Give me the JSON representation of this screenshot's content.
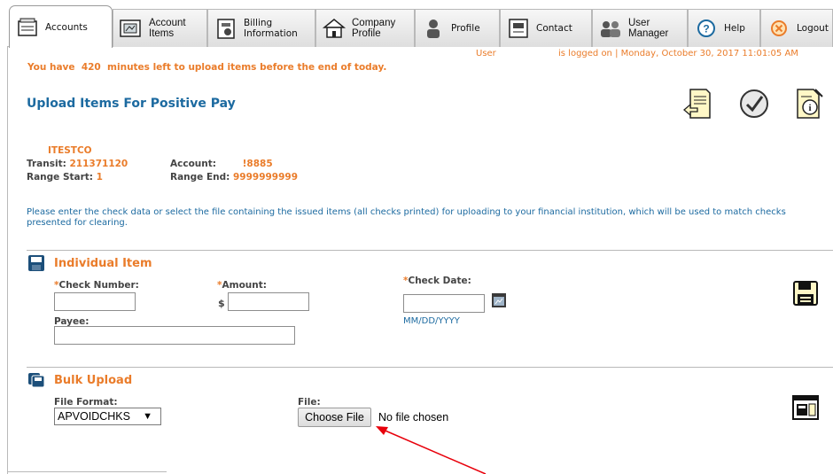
{
  "nav": {
    "tabs": [
      {
        "label": "Accounts",
        "icon": "accounts-icon"
      },
      {
        "label": "Account\nItems",
        "icon": "account-items-icon"
      },
      {
        "label": "Billing\nInformation",
        "icon": "billing-icon"
      },
      {
        "label": "Company\nProfile",
        "icon": "company-profile-icon"
      },
      {
        "label": "Profile",
        "icon": "profile-icon"
      },
      {
        "label": "Contact",
        "icon": "contact-icon"
      },
      {
        "label": "User\nManager",
        "icon": "user-manager-icon"
      },
      {
        "label": "Help",
        "icon": "help-icon"
      },
      {
        "label": "Logout",
        "icon": "logout-icon"
      }
    ]
  },
  "status": {
    "user": "User",
    "logged_on": "is logged on | Monday, October 30, 2017 11:01:05 AM",
    "minutes": "You have  420  minutes left to upload items before the end of today."
  },
  "page": {
    "title": "Upload Items For Positive Pay",
    "company": "ITESTCO",
    "transit_label": "Transit:",
    "transit_value": "211371120",
    "account_label": "Account:",
    "account_value": "!8885",
    "range_start_label": "Range Start:",
    "range_start_value": "1",
    "range_end_label": "Range End:",
    "range_end_value": "9999999999",
    "instructions": "Please enter the check data or select the file containing the issued items (all checks printed) for uploading to your financial institution, which will be used to match checks presented for clearing."
  },
  "individual": {
    "title": "Individual Item",
    "check_number_label": "Check Number:",
    "amount_label": "Amount:",
    "check_date_label": "Check Date:",
    "required_mark": "*",
    "dollar": "$",
    "payee_label": "Payee:",
    "date_format": "MM/DD/YYYY",
    "check_number_value": "",
    "amount_value": "",
    "check_date_value": "",
    "payee_value": ""
  },
  "bulk": {
    "title": "Bulk Upload",
    "file_format_label": "File Format:",
    "file_format_value": "APVOIDCHKS",
    "file_label": "File:",
    "choose_file": "Choose File",
    "no_file": "No file chosen"
  },
  "colors": {
    "accent_orange": "#ea7c2a",
    "accent_blue": "#1c6aa0",
    "annotation_red": "#e8000b"
  }
}
